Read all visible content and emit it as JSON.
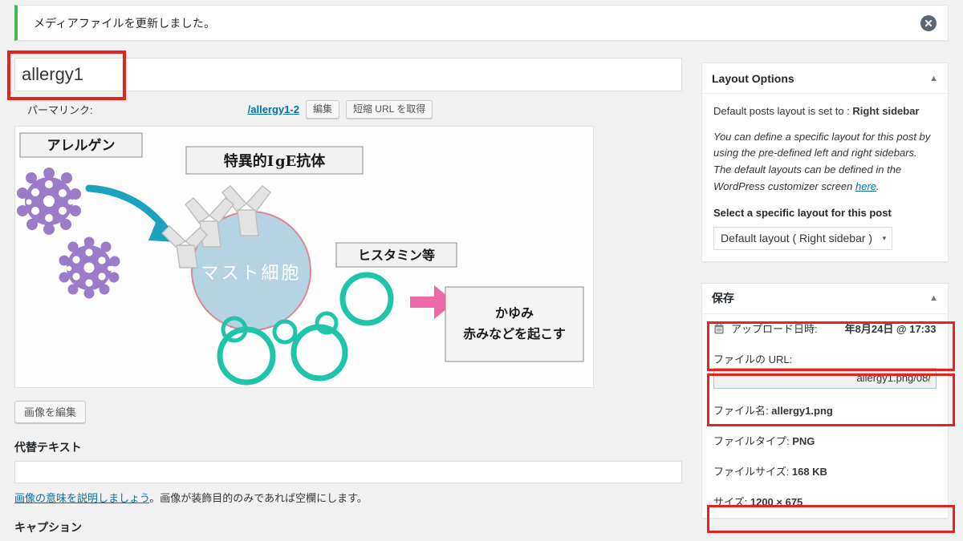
{
  "notice": {
    "message": "メディアファイルを更新しました。",
    "dismiss_icon": "close-circle-icon",
    "accent_color": "#46b450"
  },
  "editor": {
    "title_value": "allergy1",
    "permalink_label": "パーマリンク:",
    "permalink_url": "/allergy1-2",
    "edit_button": "編集",
    "shortlink_button": "短縮 URL を取得",
    "edit_image_button": "画像を編集",
    "alt_text_label": "代替テキスト",
    "alt_text_value": "",
    "alt_help_link": "画像の意味を説明しましょう",
    "alt_help_rest": "。画像が装飾目的のみであれば空欄にします。",
    "caption_label": "キャプション"
  },
  "image": {
    "label_allergen": "アレルゲン",
    "label_ige": "特異的IgE抗体",
    "label_histamine": "ヒスタミン等",
    "label_mastcell": "マスト細胞",
    "label_outcome_line1": "かゆみ",
    "label_outcome_line2": "赤みなどを起こす",
    "colors": {
      "allergen": "#9b7cc8",
      "arrow_teal": "#1ba3bd",
      "mastcell_fill": "#b3d4e0",
      "mastcell_stroke": "#e08497",
      "granule": "#1fc5a8",
      "arrow_pink": "#ec6ba6"
    }
  },
  "layout_options": {
    "panel_title": "Layout Options",
    "toggle_icon": "chevron-up-icon",
    "default_line_prefix": "Default posts layout is set to : ",
    "default_line_value": "Right sidebar",
    "description": "You can define a specific layout for this post by using the pre-defined left and right sidebars. The default layouts can be defined in the WordPress customizer screen ",
    "description_link": "here",
    "description_end": ".",
    "select_label": "Select a specific layout for this post",
    "select_value": "Default layout ( Right sidebar )",
    "select_caret": "▾"
  },
  "save_panel": {
    "panel_title": "保存",
    "toggle_icon": "chevron-up-icon",
    "upload_icon": "calendar-icon",
    "upload_label": "アップロード日時:",
    "upload_value": "年8月24日 @ 17:33",
    "file_url_label": "ファイルの URL:",
    "file_url_value": "/08/allergy1.png",
    "filename_label": "ファイル名:",
    "filename_value": "allergy1.png",
    "filetype_label": "ファイルタイプ:",
    "filetype_value": "PNG",
    "filesize_label": "ファイルサイズ:",
    "filesize_value": "168 KB",
    "dimensions_label": "サイズ:",
    "dimensions_value": "1200 × 675"
  },
  "highlight_color": "#e8221f"
}
